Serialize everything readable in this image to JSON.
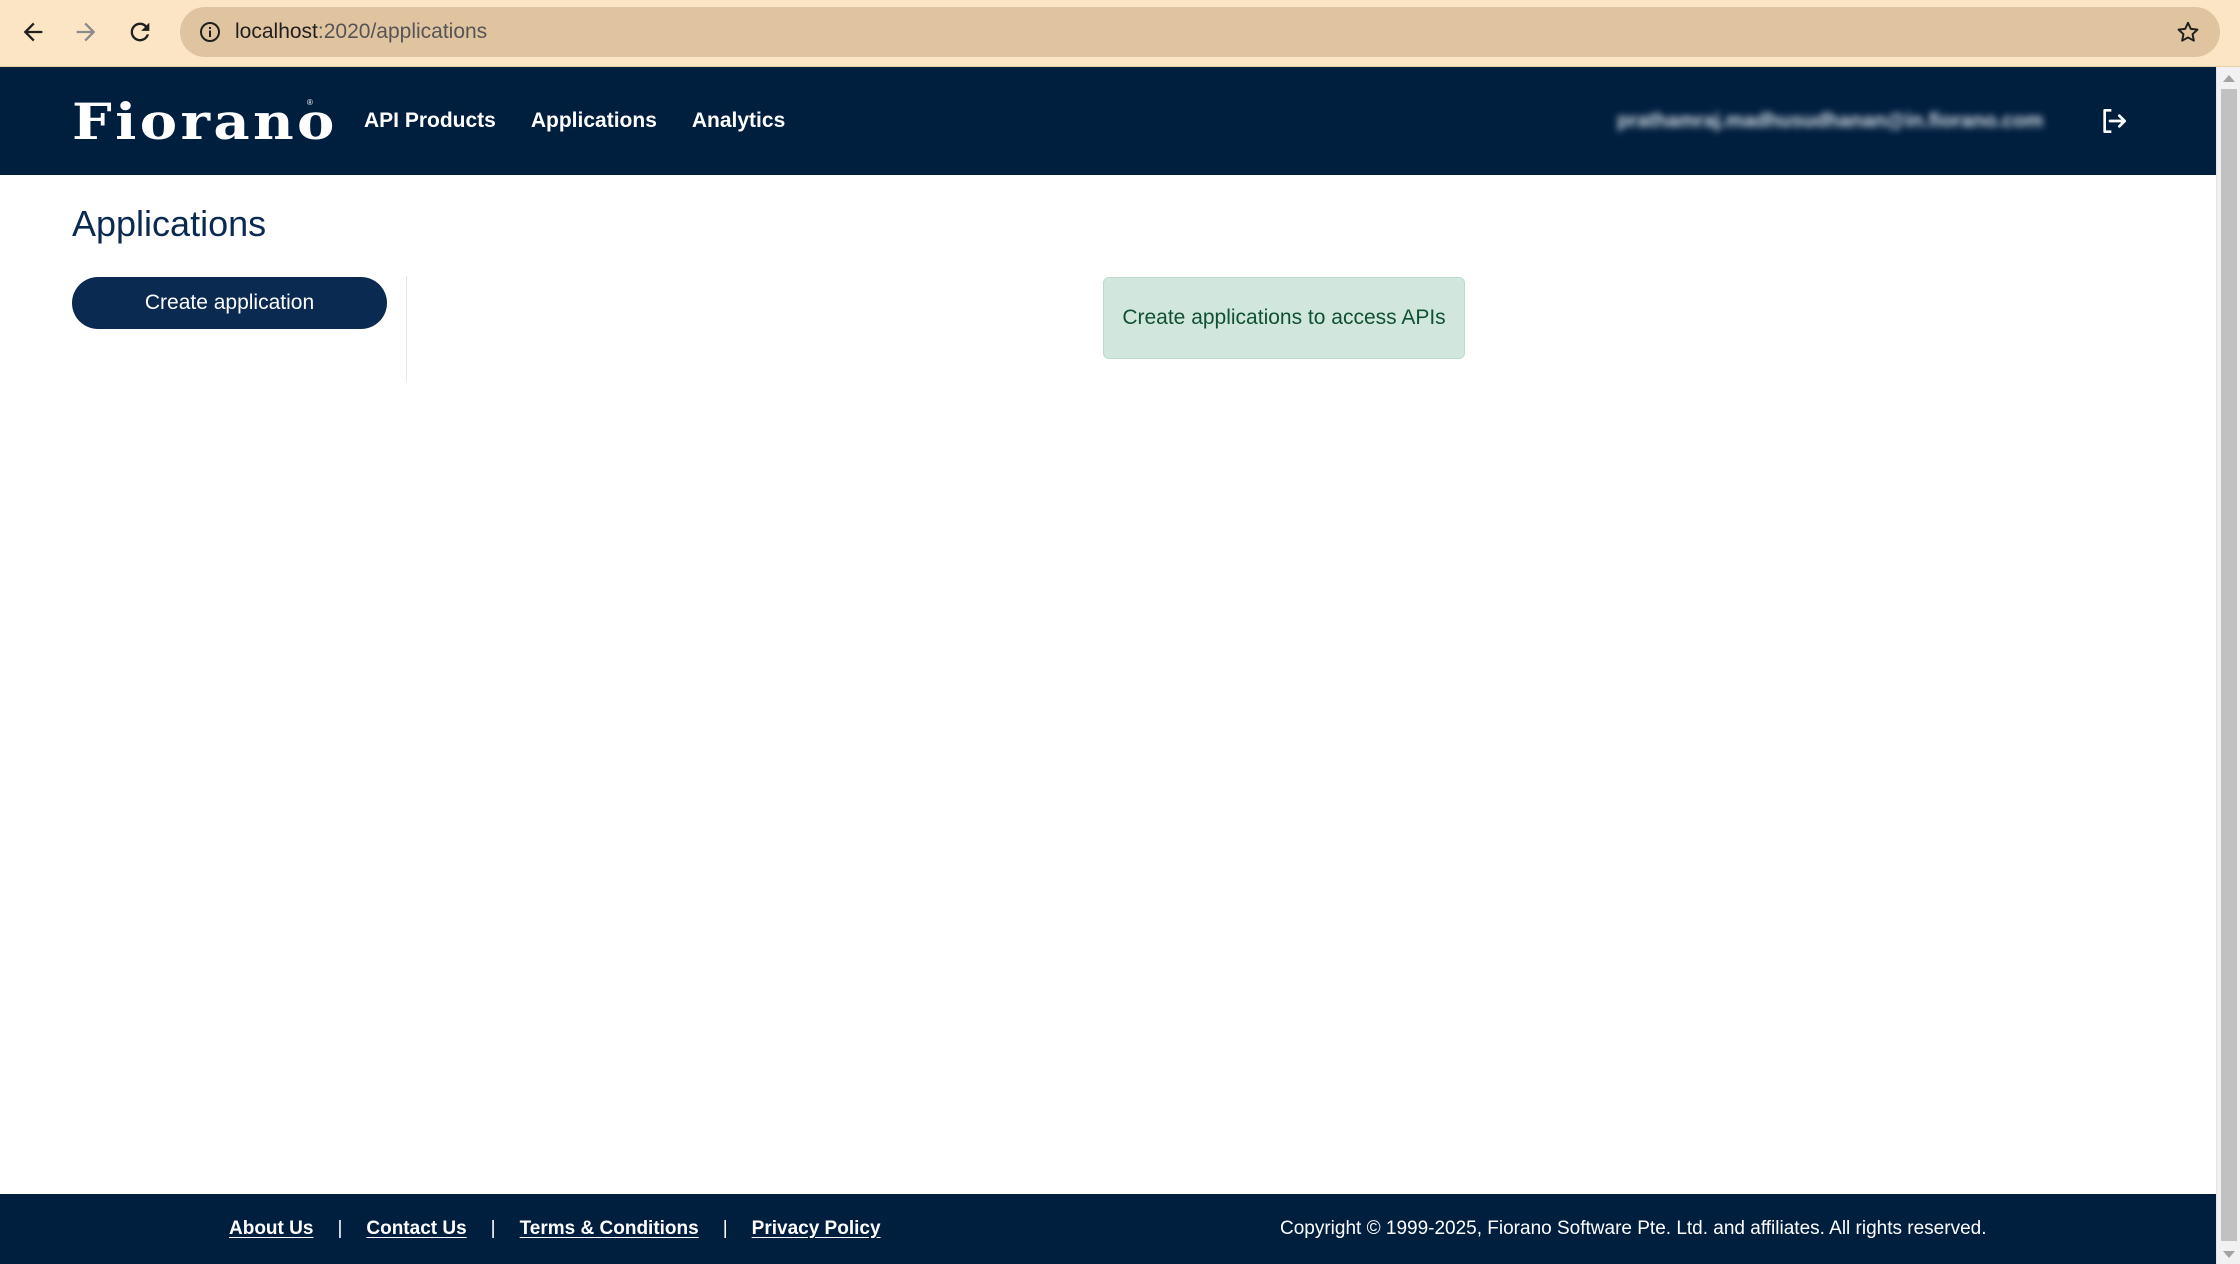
{
  "browser": {
    "url_host": "localhost",
    "url_path": ":2020/applications",
    "theme_color": "#fce5c4"
  },
  "header": {
    "logo_text": "Fiorano",
    "nav": [
      {
        "label": "API Products"
      },
      {
        "label": "Applications"
      },
      {
        "label": "Analytics"
      }
    ],
    "user_email": "prathamraj.madhusudhanan@in.fiorano.com",
    "logout_icon": "logout-icon",
    "background": "#001f3f"
  },
  "page": {
    "title": "Applications",
    "create_button": "Create application",
    "empty_message": "Create applications to access APIs"
  },
  "footer": {
    "links": [
      {
        "label": "About Us"
      },
      {
        "label": "Contact Us"
      },
      {
        "label": "Terms & Conditions"
      },
      {
        "label": "Privacy Policy"
      }
    ],
    "separator": "|",
    "copyright": "Copyright © 1999-2025, Fiorano Software Pte. Ltd. and affiliates. All rights reserved."
  }
}
